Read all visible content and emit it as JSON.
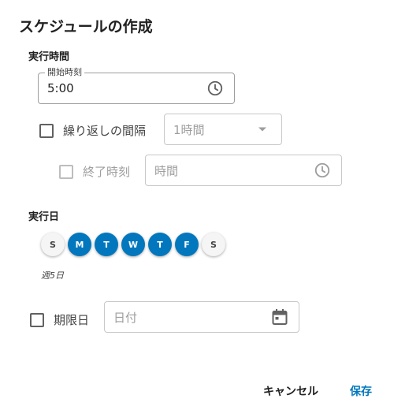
{
  "dialog": {
    "title": "スケジュールの作成",
    "run_time": {
      "section_label": "実行時間",
      "start_time": {
        "label": "開始時刻",
        "value": "5:00",
        "icon": "clock-icon"
      },
      "repeat": {
        "label": "繰り返しの間隔",
        "checked": false,
        "interval_placeholder": "1時間",
        "icon": "dropdown-arrow-icon"
      },
      "end_time": {
        "label": "終了時刻",
        "checked": false,
        "disabled": true,
        "placeholder": "時間",
        "icon": "clock-icon"
      }
    },
    "run_days": {
      "section_label": "実行日",
      "days": [
        {
          "label": "S",
          "selected": false
        },
        {
          "label": "M",
          "selected": true
        },
        {
          "label": "T",
          "selected": true
        },
        {
          "label": "W",
          "selected": true
        },
        {
          "label": "T",
          "selected": true
        },
        {
          "label": "F",
          "selected": true
        },
        {
          "label": "S",
          "selected": false
        }
      ],
      "summary": "週5日"
    },
    "expiry": {
      "label": "期限日",
      "checked": false,
      "date_placeholder": "日付",
      "icon": "calendar-icon"
    },
    "actions": {
      "cancel_label": "キャンセル",
      "save_label": "保存"
    },
    "colors": {
      "accent": "#0277bd",
      "text": "#212121",
      "muted": "#9e9e9e"
    }
  }
}
